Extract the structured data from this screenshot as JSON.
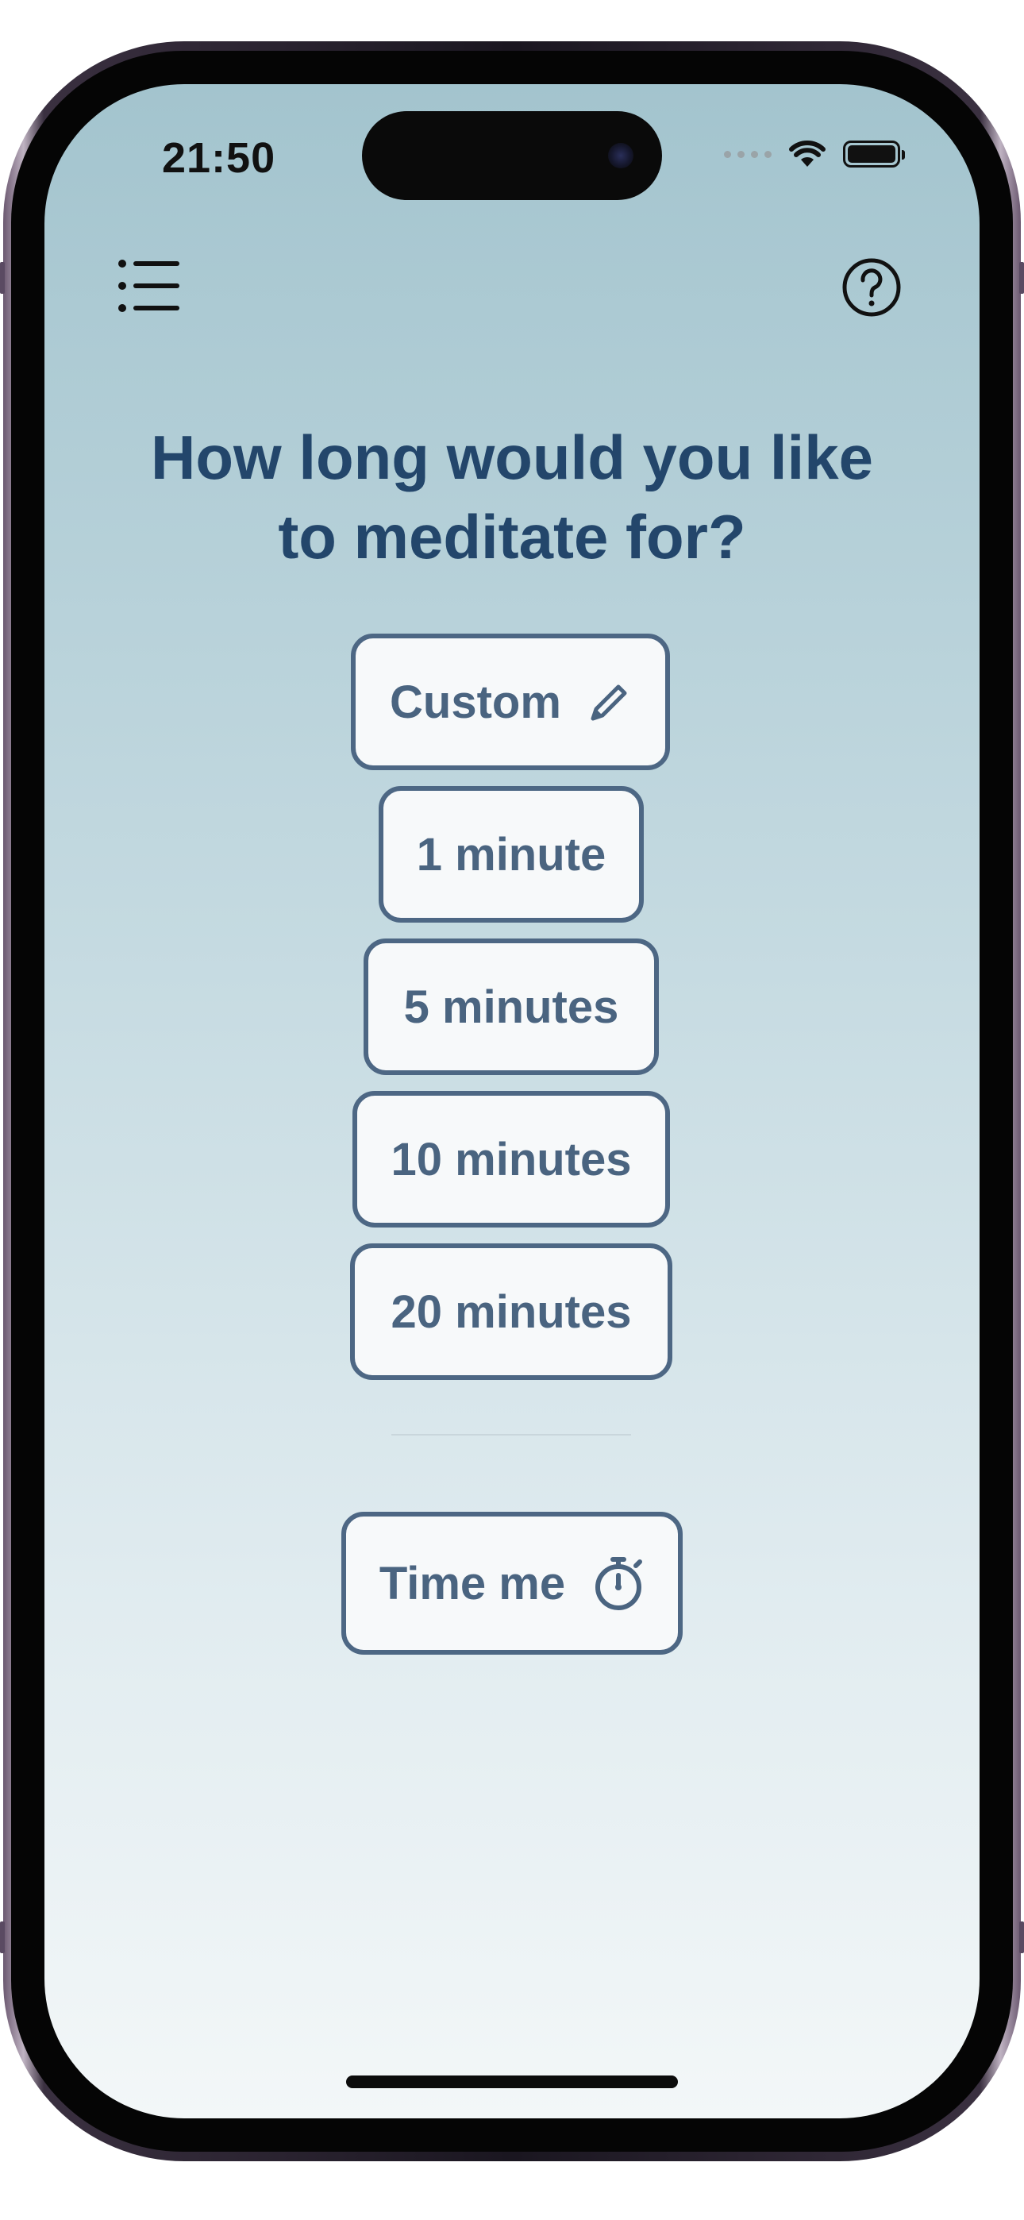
{
  "status_bar": {
    "time": "21:50",
    "signal_icon": "cellular-dots-icon",
    "wifi_icon": "wifi-icon",
    "battery_icon": "battery-icon"
  },
  "nav": {
    "menu_icon": "list-icon",
    "help_icon": "question-circle-icon"
  },
  "title": {
    "line1": "How long would you like",
    "line2": "to meditate for?"
  },
  "options": [
    {
      "label": "Custom",
      "icon": "pencil-icon"
    },
    {
      "label": "1 minute"
    },
    {
      "label": "5 minutes"
    },
    {
      "label": "10 minutes"
    },
    {
      "label": "20 minutes"
    }
  ],
  "timer": {
    "label": "Time me",
    "icon": "stopwatch-icon"
  },
  "colors": {
    "accent": "#4d6784",
    "title": "#23466b",
    "background_top": "#a3c4ce",
    "background_bottom": "#f3f7f8"
  }
}
